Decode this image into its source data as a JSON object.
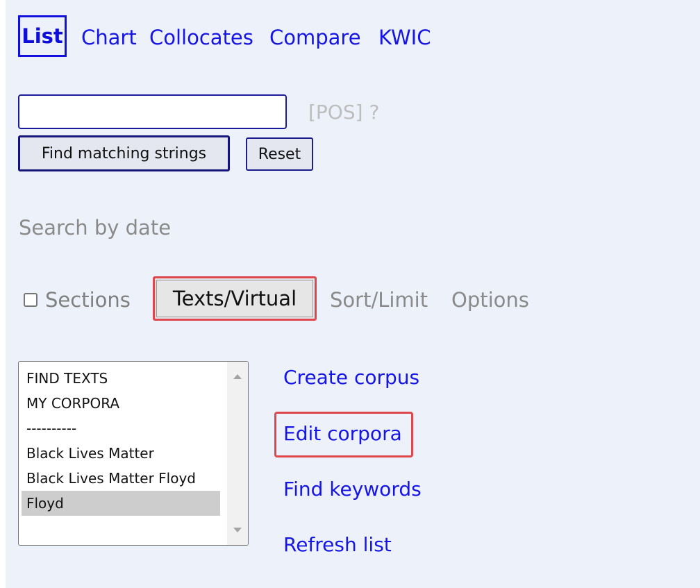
{
  "tabs": [
    {
      "label": "List"
    },
    {
      "label": "Chart"
    },
    {
      "label": "Collocates"
    },
    {
      "label": "Compare"
    },
    {
      "label": "KWIC"
    }
  ],
  "search": {
    "value": "",
    "pos_label": "[POS] ?"
  },
  "buttons": {
    "find": "Find matching strings",
    "reset": "Reset"
  },
  "search_by_date": "Search by date",
  "options_row": {
    "sections": "Sections",
    "texts_virtual": "Texts/Virtual",
    "sort_limit": "Sort/Limit",
    "options": "Options"
  },
  "listbox": {
    "items": [
      "FIND TEXTS",
      "MY CORPORA",
      "----------",
      "Black Lives Matter",
      "Black Lives Matter Floyd",
      "Floyd"
    ],
    "selected": "Floyd"
  },
  "side_links": {
    "create": "Create corpus",
    "edit": "Edit corpora",
    "keywords": "Find keywords",
    "refresh": "Refresh list"
  },
  "colors": {
    "panel_bg": "#edf1f9",
    "link": "#1515e8",
    "highlight": "#e0474c"
  }
}
